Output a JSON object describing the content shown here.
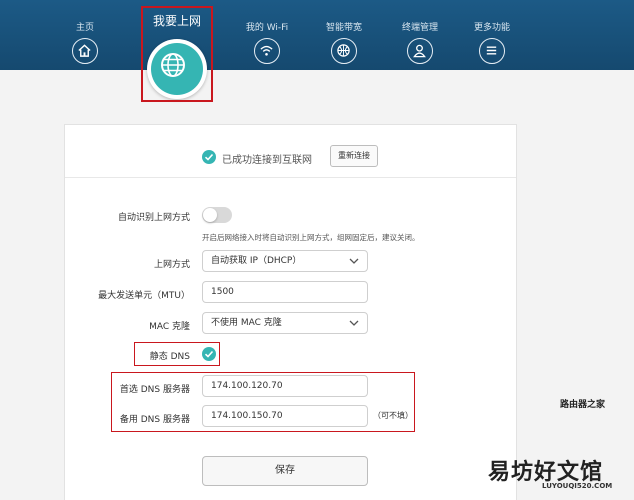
{
  "nav": {
    "items": [
      {
        "label": "主页",
        "icon": "home-icon"
      },
      {
        "label": "我要上网",
        "icon": "globe-icon",
        "active": true
      },
      {
        "label": "我的 Wi-Fi",
        "icon": "wifi-icon"
      },
      {
        "label": "智能带宽",
        "icon": "bandwidth-icon"
      },
      {
        "label": "终端管理",
        "icon": "user-icon"
      },
      {
        "label": "更多功能",
        "icon": "menu-icon"
      }
    ]
  },
  "status": {
    "text": "已成功连接到互联网",
    "reconnect_label": "重新连接"
  },
  "form": {
    "auto_detect": {
      "label": "自动识别上网方式",
      "enabled": false,
      "hint": "开启后网络接入时将自动识别上网方式，组网固定后，建议关闭。"
    },
    "wan_mode": {
      "label": "上网方式",
      "value": "自动获取 IP（DHCP）"
    },
    "mtu": {
      "label": "最大发送单元（MTU）",
      "value": "1500"
    },
    "mac_clone": {
      "label": "MAC 克隆",
      "value": "不使用 MAC 克隆"
    },
    "static_dns": {
      "label": "静态 DNS",
      "checked": true
    },
    "primary_dns": {
      "label": "首选 DNS 服务器",
      "value": "174.100.120.70"
    },
    "secondary_dns": {
      "label": "备用 DNS 服务器",
      "value": "174.100.150.70",
      "note": "（可不填）"
    },
    "save_label": "保存"
  },
  "watermark": {
    "top": "路由器之家",
    "text": "易坊好文馆",
    "url": "LUYOUQI520.COM"
  },
  "colors": {
    "header": "#1c5a86",
    "accent": "#35b5b3",
    "highlight": "#c9171e"
  }
}
